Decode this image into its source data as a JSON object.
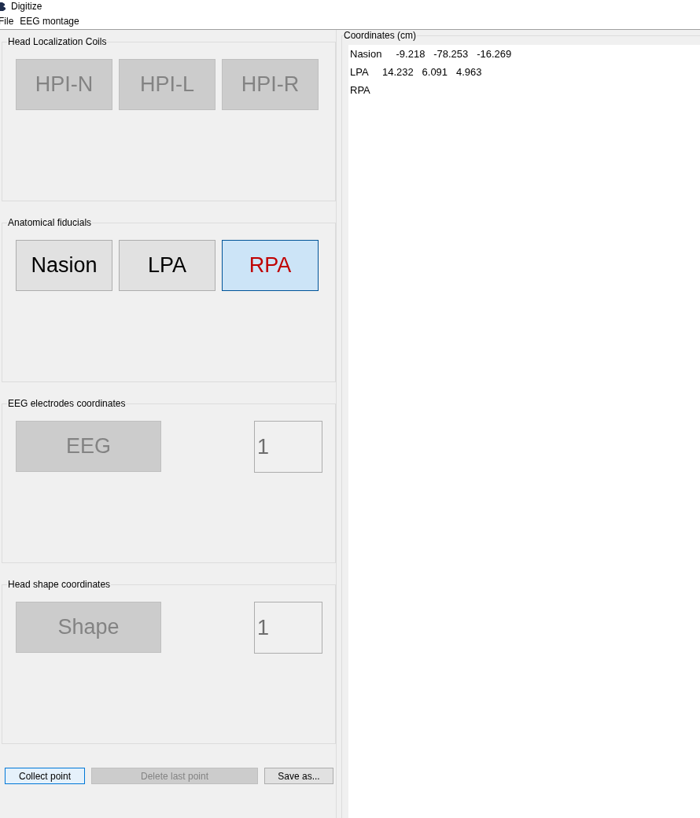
{
  "window": {
    "title": "Digitize"
  },
  "menu": [
    "File",
    "EEG montage"
  ],
  "groups": [
    {
      "title": "Head Localization Coils",
      "items": [
        {
          "kind": "button",
          "label": "HPI-N",
          "disabled": true,
          "selected": false
        },
        {
          "kind": "button",
          "label": "HPI-L",
          "disabled": true,
          "selected": false
        },
        {
          "kind": "button",
          "label": "HPI-R",
          "disabled": true,
          "selected": false
        }
      ]
    },
    {
      "title": "Anatomical fiducials",
      "items": [
        {
          "kind": "button",
          "label": "Nasion",
          "disabled": false,
          "selected": false
        },
        {
          "kind": "button",
          "label": "LPA",
          "disabled": false,
          "selected": false
        },
        {
          "kind": "button",
          "label": "RPA",
          "disabled": false,
          "selected": true
        }
      ]
    },
    {
      "title": "EEG electrodes coordinates",
      "items": [
        {
          "kind": "wide-button",
          "label": "EEG",
          "disabled": true,
          "selected": false
        },
        {
          "kind": "counter",
          "value": "1"
        }
      ]
    },
    {
      "title": "Head shape coordinates",
      "items": [
        {
          "kind": "wide-button",
          "label": "Shape",
          "disabled": true,
          "selected": false
        },
        {
          "kind": "counter",
          "value": "1"
        }
      ]
    }
  ],
  "coordinates": {
    "title": "Coordinates (cm)",
    "lines": [
      "Nasion     -9.218   -78.253   -16.269",
      "LPA     14.232   6.091   4.963",
      "RPA"
    ]
  },
  "actions": [
    {
      "label": "Collect point",
      "disabled": false,
      "focused": true
    },
    {
      "label": "Delete last point",
      "disabled": true,
      "focused": false
    },
    {
      "label": "Save as...",
      "disabled": false,
      "focused": false
    }
  ]
}
